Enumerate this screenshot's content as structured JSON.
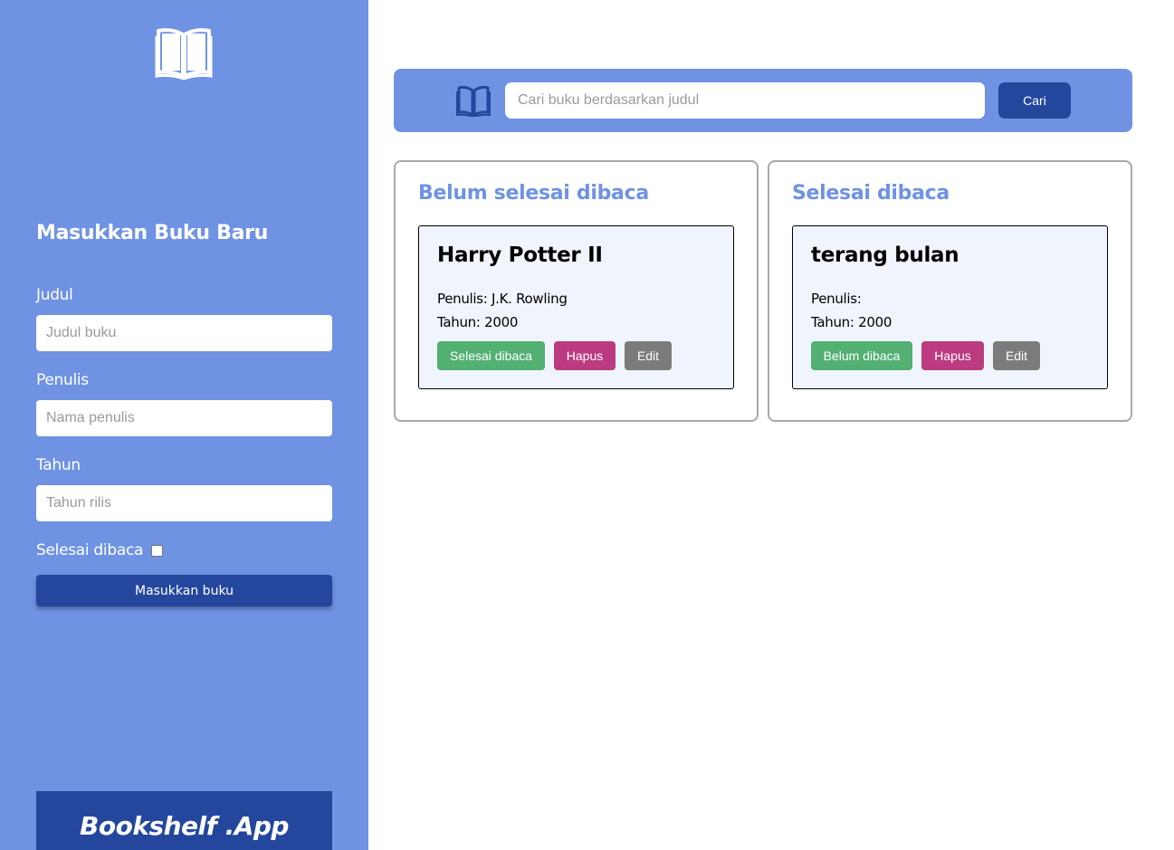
{
  "sidebar": {
    "title": "Masukkan Buku Baru",
    "fields": [
      {
        "label": "Judul",
        "placeholder": "Judul buku"
      },
      {
        "label": "Penulis",
        "placeholder": "Nama penulis"
      },
      {
        "label": "Tahun",
        "placeholder": "Tahun rilis"
      }
    ],
    "checkbox_label": "Selesai dibaca",
    "submit_label": "Masukkan buku",
    "brand": "Bookshelf .App"
  },
  "search": {
    "placeholder": "Cari buku berdasarkan judul",
    "button_label": "Cari"
  },
  "shelves": [
    {
      "title": "Belum selesai dibaca",
      "books": [
        {
          "title": "Harry Potter II",
          "author_line": "Penulis: J.K. Rowling",
          "year_line": "Tahun: 2000",
          "actions": [
            "Selesai dibaca",
            "Hapus",
            "Edit"
          ]
        }
      ]
    },
    {
      "title": "Selesai dibaca",
      "books": [
        {
          "title": "terang bulan",
          "author_line": "Penulis:",
          "year_line": "Tahun: 2000",
          "actions": [
            "Belum dibaca",
            "Hapus",
            "Edit"
          ]
        }
      ]
    }
  ],
  "colors": {
    "primary": "#6f92e3",
    "dark": "#24479d",
    "done": "#52b072",
    "delete": "#bb3a80",
    "edit": "#7b7b7b"
  },
  "icons": [
    "open-book-icon"
  ]
}
